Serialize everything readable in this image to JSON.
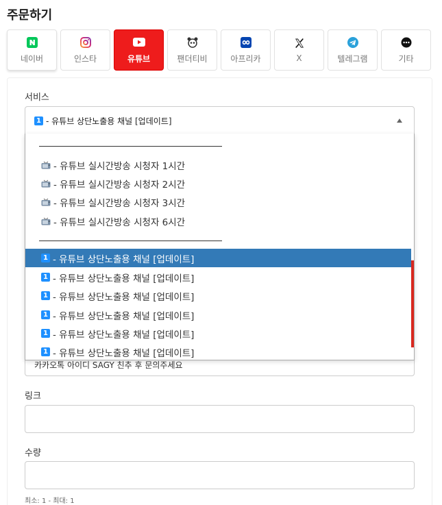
{
  "page": {
    "title": "주문하기"
  },
  "tabs": [
    {
      "label": "네이버",
      "icon": "naver-icon",
      "active": false
    },
    {
      "label": "인스타",
      "icon": "instagram-icon",
      "active": false
    },
    {
      "label": "유튜브",
      "icon": "youtube-icon",
      "active": true
    },
    {
      "label": "팬더티비",
      "icon": "pandatv-icon",
      "active": false
    },
    {
      "label": "아프리카",
      "icon": "afreeca-icon",
      "active": false
    },
    {
      "label": "X",
      "icon": "x-icon",
      "active": false
    },
    {
      "label": "텔레그램",
      "icon": "telegram-icon",
      "active": false
    },
    {
      "label": "기타",
      "icon": "more-icon",
      "active": false
    }
  ],
  "service": {
    "label": "서비스",
    "selected_badge": "1",
    "selected_text": " - 유튜브 상단노출용 채널 [업데이트]"
  },
  "dropdown": {
    "items": [
      {
        "icon": "tv-icon",
        "text": " - 유튜브 실시간방송 시청자 1시간"
      },
      {
        "icon": "tv-icon",
        "text": " - 유튜브 실시간방송 시청자 2시간"
      },
      {
        "icon": "tv-icon",
        "text": " - 유튜브 실시간방송 시청자 3시간"
      },
      {
        "icon": "tv-icon",
        "text": " - 유튜브 실시간방송 시청자 6시간"
      },
      {
        "badge": "1",
        "text": " - 유튜브 상단노출용 채널 [업데이트]",
        "selected": true
      },
      {
        "badge": "1",
        "text": " - 유튜브 상단노출용 채널 [업데이트]"
      },
      {
        "badge": "1",
        "text": " - 유튜브 상단노출용 채널 [업데이트]"
      },
      {
        "badge": "1",
        "text": " - 유튜브 상단노출용 채널 [업데이트]"
      },
      {
        "badge": "1",
        "text": " - 유튜브 상단노출용 채널 [업데이트]"
      },
      {
        "badge": "1",
        "text": " - 유튜브 상단노출용 채널 [업데이트]"
      }
    ]
  },
  "description": {
    "text": "카카오톡 아이디 SAGY 친추 후 문의주세요"
  },
  "link": {
    "label": "링크",
    "value": ""
  },
  "quantity": {
    "label": "수량",
    "value": "",
    "hint": "최소: 1 - 최대: 1"
  },
  "colors": {
    "accent": "#ee1c1c",
    "selected_row": "#337ab7",
    "badge": "#1e90ff"
  }
}
